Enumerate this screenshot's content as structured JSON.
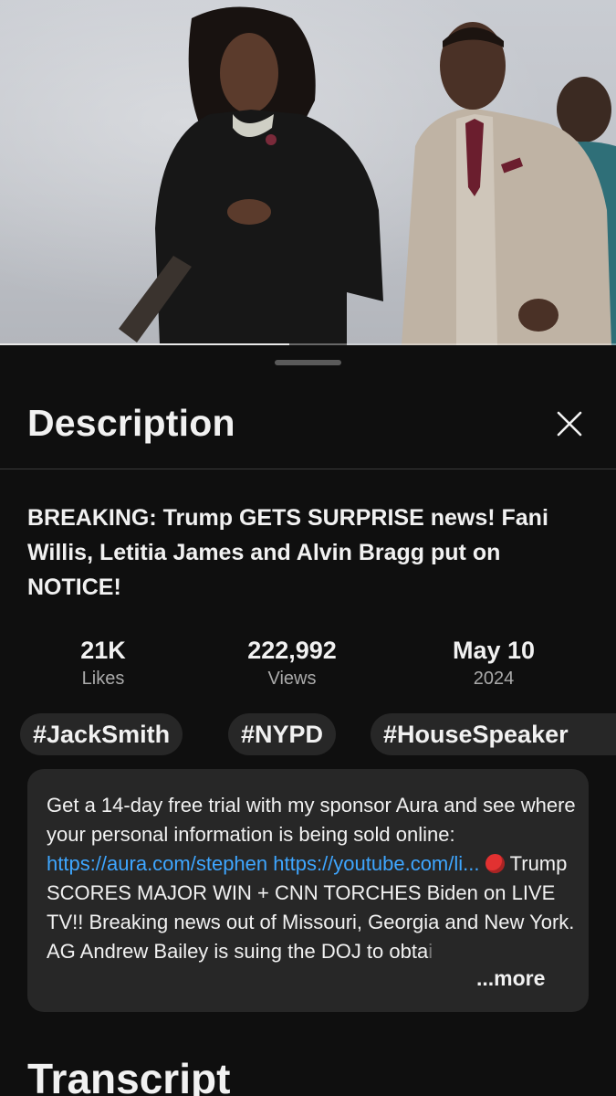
{
  "video": {
    "progress_fraction": 0.47
  },
  "sheet": {
    "title": "Description",
    "close_icon": "close-icon"
  },
  "video_title": "BREAKING: Trump GETS SURPRISE news! Fani Willis, Letitia James and Alvin Bragg put on NOTICE!",
  "stats": [
    {
      "value": "21K",
      "label": "Likes"
    },
    {
      "value": "222,992",
      "label": "Views"
    },
    {
      "value": "May 10",
      "label": "2024"
    }
  ],
  "tags": [
    "#JackSmith",
    "#NYPD",
    "#HouseSpeaker"
  ],
  "description": {
    "text_1": "Get a 14-day free trial with my sponsor Aura and see where your personal information is being sold online: ",
    "link_1": "https://aura.com/stephen",
    "link_2": "https://youtube.com/li...",
    "emoji": "red-circle-icon",
    "text_2": "Trump SCORES MAJOR WIN + CNN TORCHES Biden on LIVE TV!!  Breaking news out of Missouri, Georgia and New York. AG Andrew Bailey is suing the DOJ to obta",
    "text_fade": "i",
    "more_label": "...more"
  },
  "section": {
    "transcript_title": "Transcript"
  },
  "colors": {
    "background": "#0f0f0f",
    "surface": "#272727",
    "link": "#3ea6ff",
    "muted_text": "#aaaaaa"
  }
}
